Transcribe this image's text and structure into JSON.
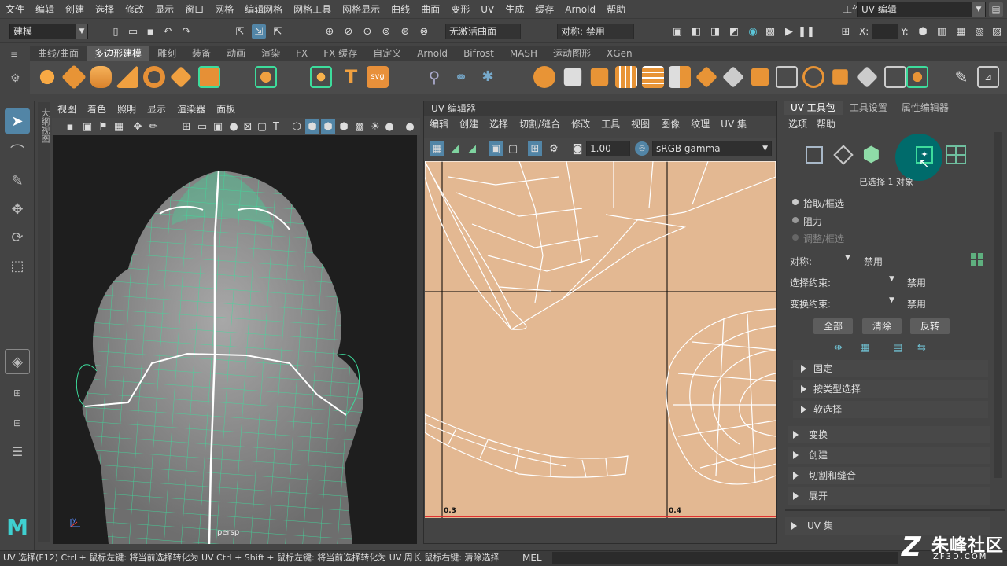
{
  "menubar": {
    "items": [
      "文件",
      "编辑",
      "创建",
      "选择",
      "修改",
      "显示",
      "窗口",
      "网格",
      "编辑网格",
      "网格工具",
      "网格显示",
      "曲线",
      "曲面",
      "变形",
      "UV",
      "生成",
      "缓存",
      "Arnold",
      "帮助"
    ],
    "workspace_label": "工作区:",
    "workspace_value": "UV 编辑"
  },
  "statusline": {
    "mode": "建模",
    "live_surface": "无激活曲面",
    "symmetry": "对称: 禁用",
    "x_label": "X:",
    "y_label": "Y:"
  },
  "shelf": {
    "tabs": [
      "曲线/曲面",
      "多边形建模",
      "雕刻",
      "装备",
      "动画",
      "渲染",
      "FX",
      "FX 缓存",
      "自定义",
      "Arnold",
      "Bifrost",
      "MASH",
      "运动图形",
      "XGen"
    ],
    "active_tab": 1
  },
  "viewport": {
    "menu": [
      "视图",
      "着色",
      "照明",
      "显示",
      "渲染器",
      "面板"
    ],
    "side_label": "大纲视图",
    "camera": "persp"
  },
  "uv_editor": {
    "title": "UV 编辑器",
    "menu": [
      "编辑",
      "创建",
      "选择",
      "切割/缝合",
      "修改",
      "工具",
      "视图",
      "图像",
      "纹理",
      "UV 集"
    ],
    "exposure": "1.00",
    "colorspace": "sRGB gamma",
    "tick_left": "0.3",
    "tick_right": "0.4"
  },
  "uv_toolkit": {
    "tabs": [
      "UV 工具包",
      "工具设置",
      "属性编辑器"
    ],
    "menu": [
      "选项",
      "帮助"
    ],
    "selection_info": "已选择 1 对象",
    "radios": [
      "拾取/框选",
      "阻力",
      "调整/框选"
    ],
    "symmetry_label": "对称:",
    "symmetry_value": "禁用",
    "select_constraint_label": "选择约束:",
    "select_constraint_value": "禁用",
    "transform_constraint_label": "变换约束:",
    "transform_constraint_value": "禁用",
    "buttons": [
      "全部",
      "清除",
      "反转"
    ],
    "subsections": [
      "固定",
      "按类型选择",
      "软选择"
    ],
    "sections": [
      "变换",
      "创建",
      "切割和缝合",
      "展开"
    ],
    "uvset_section": "UV 集"
  },
  "bottombar": {
    "help_text": "UV 选择(F12) Ctrl + 鼠标左键: 将当前选择转化为 UV Ctrl + Shift + 鼠标左键: 将当前选择转化为 UV 周长 鼠标右键: 清除选择",
    "mel_label": "MEL"
  },
  "watermark": {
    "text": "朱峰社区",
    "url": "ZF3D.COM"
  },
  "colors": {
    "accent": "#5285a6",
    "wire": "#3ddc9c",
    "uv_bg": "#e3b892",
    "highlight": "#006b6b"
  }
}
